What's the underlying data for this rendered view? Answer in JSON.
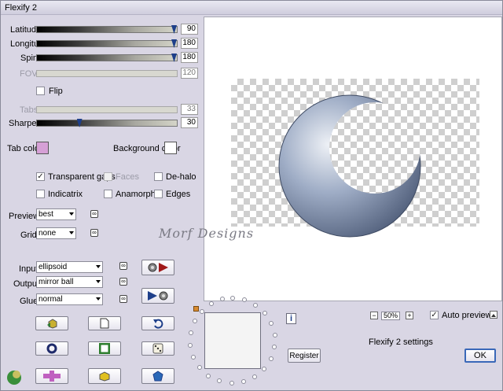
{
  "window": {
    "title": "Flexify 2"
  },
  "sliders": [
    {
      "label": "Latitude",
      "value": "90",
      "fill": 1.0,
      "enabled": true
    },
    {
      "label": "Longitude",
      "value": "180",
      "fill": 1.0,
      "enabled": true
    },
    {
      "label": "Spin",
      "value": "180",
      "fill": 1.0,
      "enabled": true
    },
    {
      "label": "FOV",
      "value": "120",
      "fill": 0.0,
      "enabled": false
    },
    {
      "label": "Tabs",
      "value": "33",
      "fill": 0.0,
      "enabled": false
    },
    {
      "label": "Sharpen",
      "value": "30",
      "fill": 0.3,
      "enabled": true
    }
  ],
  "flip": {
    "label": "Flip",
    "checked": false
  },
  "colors": {
    "tab_label": "Tab color",
    "tab_color": "#d6a0d6",
    "background_label": "Background color",
    "background_color": "#ffffff"
  },
  "checkboxes": {
    "transparent_gaps": {
      "label": "Transparent gaps",
      "checked": true
    },
    "faces": {
      "label": "Faces",
      "checked": false
    },
    "de_halo": {
      "label": "De-halo",
      "checked": false
    },
    "indicatrix": {
      "label": "Indicatrix",
      "checked": false
    },
    "anamorph": {
      "label": "Anamorph",
      "checked": false
    },
    "edges": {
      "label": "Edges",
      "checked": false
    }
  },
  "preview_quality": {
    "label": "Preview",
    "value": "best"
  },
  "grid": {
    "label": "Grid",
    "value": "none"
  },
  "input": {
    "label": "Input",
    "value": "ellipsoid"
  },
  "output": {
    "label": "Output",
    "value": "mirror ball"
  },
  "glue": {
    "label": "Glue",
    "value": "normal"
  },
  "watermark": "Morf Designs",
  "zoom": {
    "value": "50%",
    "minus": "−",
    "plus": "+"
  },
  "auto_preview": {
    "label": "Auto preview",
    "checked": true
  },
  "settings_label": "Flexify 2 settings",
  "buttons": {
    "register": "Register",
    "ok": "OK",
    "info": "i"
  },
  "palette": {
    "accent": "#1e3f8a",
    "ball": "#6f7f9c",
    "play": "#a01818"
  }
}
